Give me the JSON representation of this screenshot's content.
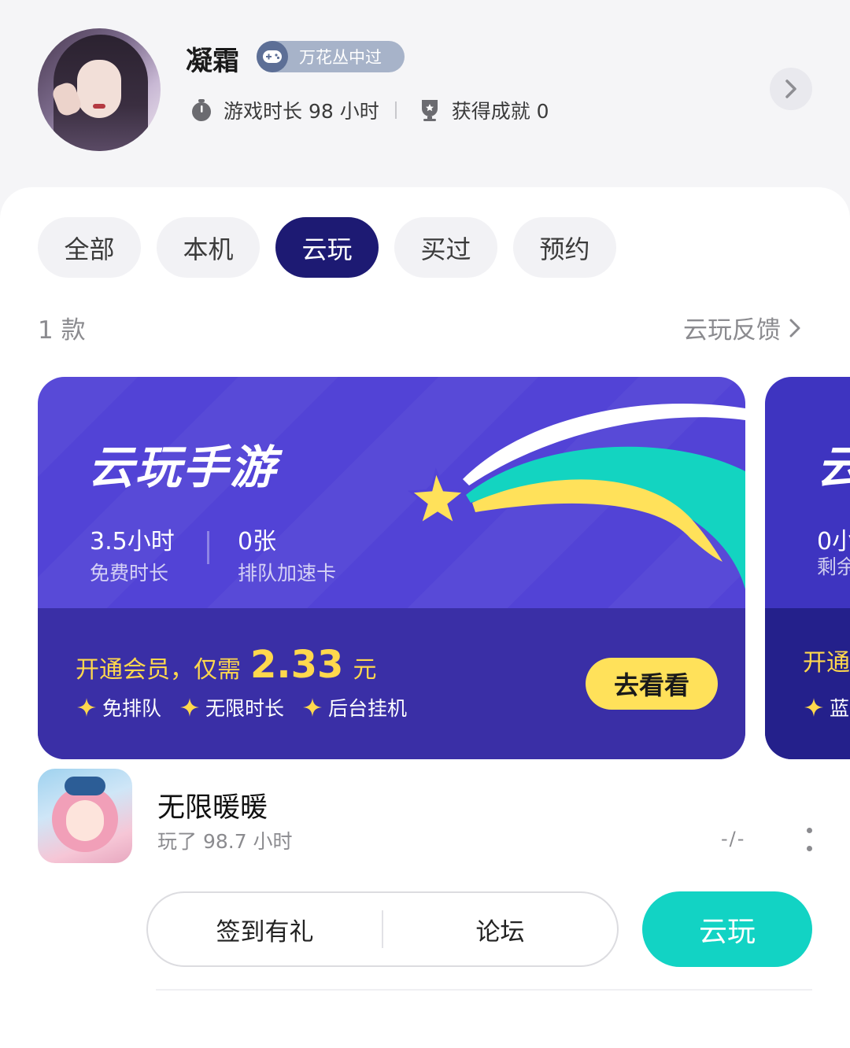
{
  "profile": {
    "name": "凝霜",
    "badge_label": "万花丛中过",
    "play_time": "游戏时长 98 小时",
    "achievements": "获得成就 0"
  },
  "tabs": [
    {
      "label": "全部",
      "active": false
    },
    {
      "label": "本机",
      "active": false
    },
    {
      "label": "云玩",
      "active": true
    },
    {
      "label": "买过",
      "active": false
    },
    {
      "label": "预约",
      "active": false
    }
  ],
  "list_header": {
    "count": "1 款",
    "feedback_label": "云玩反馈"
  },
  "banner": {
    "title": "云玩手游",
    "stat1_value": "3.5小时",
    "stat1_label": "免费时长",
    "stat2_value": "0张",
    "stat2_label": "排队加速卡",
    "promo_prefix": "开通会员，仅需",
    "promo_price": "2.33",
    "promo_unit": "元",
    "perks": [
      "免排队",
      "无限时长",
      "后台挂机"
    ],
    "button_label": "去看看",
    "colors": {
      "top": "#5243d6",
      "bottom": "#3a2fa6",
      "accent": "#ffd84d",
      "button": "#ffe15a"
    }
  },
  "banner_peek": {
    "title_fragment": "云",
    "value_fragment": "0小",
    "label_fragment": "剩余",
    "promo_fragment": "开通",
    "perk_fragment": "蓝"
  },
  "game": {
    "title": "无限暖暖",
    "subtitle": "玩了 98.7 小时",
    "score": "-/-"
  },
  "actions": {
    "checkin_label": "签到有礼",
    "forum_label": "论坛",
    "cloud_play_label": "云玩",
    "cloud_color": "#12d3c4"
  }
}
